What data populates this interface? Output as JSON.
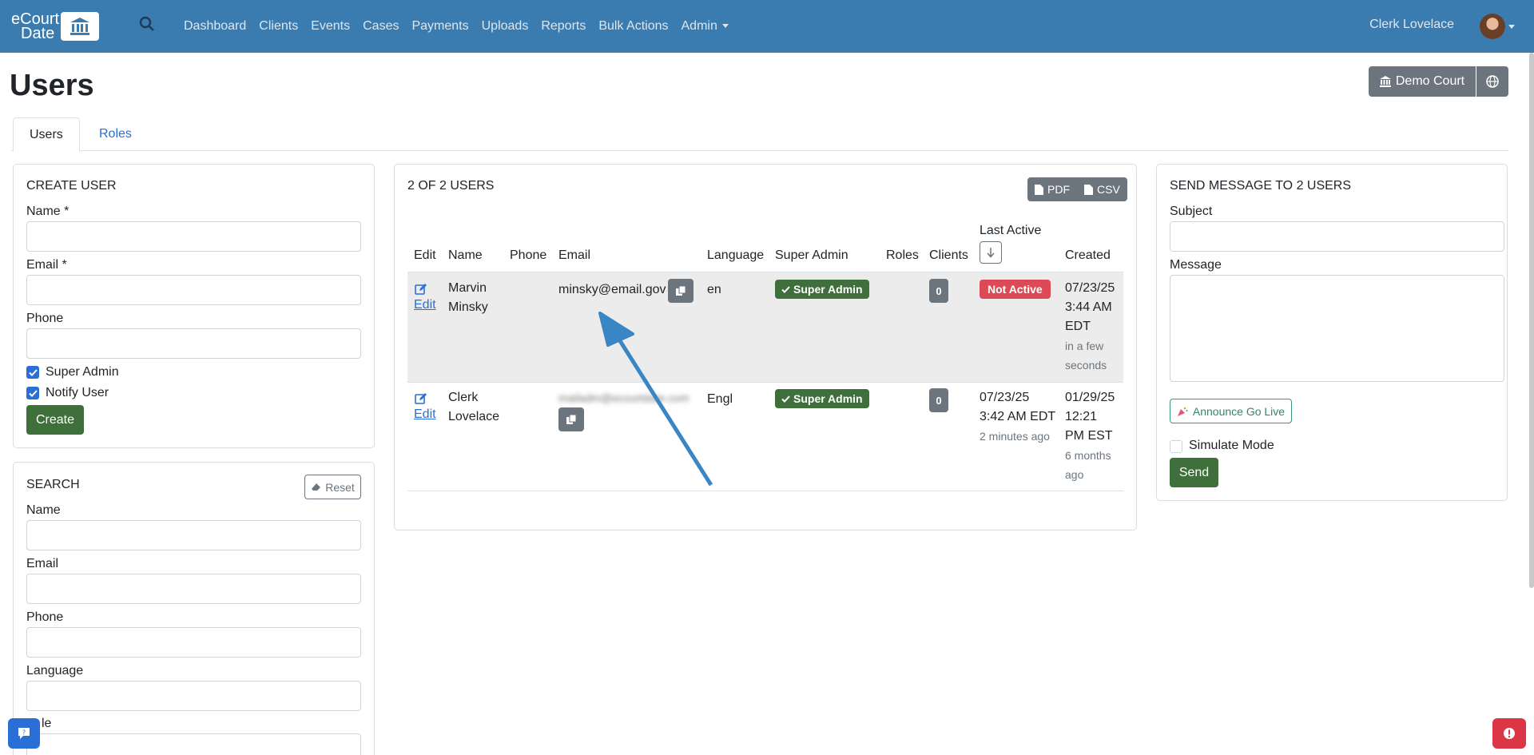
{
  "app": {
    "logo_line1": "eCourt",
    "logo_line2": "Date",
    "nav": [
      "Dashboard",
      "Clients",
      "Events",
      "Cases",
      "Payments",
      "Uploads",
      "Reports",
      "Bulk Actions",
      "Admin"
    ],
    "user_name": "Clerk Lovelace"
  },
  "page": {
    "title": "Users",
    "court_button": "Demo Court",
    "tabs": [
      "Users",
      "Roles"
    ]
  },
  "create_user": {
    "title": "CREATE USER",
    "name_label": "Name *",
    "email_label": "Email *",
    "phone_label": "Phone",
    "super_admin_label": "Super Admin",
    "super_admin_checked": true,
    "notify_user_label": "Notify User",
    "notify_user_checked": true,
    "create_button": "Create"
  },
  "search": {
    "title": "SEARCH",
    "reset_button": "Reset",
    "name_label": "Name",
    "email_label": "Email",
    "phone_label": "Phone",
    "language_label": "Language",
    "partial_label": "le"
  },
  "users_table": {
    "title": "2 OF 2 USERS",
    "pdf_button": "PDF",
    "csv_button": "CSV",
    "headers": {
      "edit": "Edit",
      "name": "Name",
      "phone": "Phone",
      "email": "Email",
      "language": "Language",
      "super_admin": "Super Admin",
      "roles": "Roles",
      "clients": "Clients",
      "last_active": "Last Active",
      "created": "Created"
    },
    "rows": [
      {
        "edit": "Edit",
        "name_line1": "Marvin",
        "name_line2": "Minsky",
        "email": "minsky@email.gov",
        "language": "en",
        "super_admin": "Super Admin",
        "clients": "0",
        "last_active_badge": "Not Active",
        "created_line1": "07/23/25",
        "created_line2": "3:44 AM",
        "created_line3": "EDT",
        "created_rel1": "in a few",
        "created_rel2": "seconds"
      },
      {
        "edit": "Edit",
        "name_line1": "Clerk",
        "name_line2": "Lovelace",
        "email_blurred": "mailadm@ecourtdate.com",
        "language": "Engl",
        "super_admin": "Super Admin",
        "clients": "0",
        "last_active_line1": "07/23/25",
        "last_active_line2": "3:42 AM EDT",
        "last_active_rel": "2 minutes ago",
        "created_line1": "01/29/25",
        "created_line2": "12:21",
        "created_line3": "PM EST",
        "created_rel1": "6 months",
        "created_rel2": "ago"
      }
    ]
  },
  "send_message": {
    "title": "SEND MESSAGE TO 2 USERS",
    "subject_label": "Subject",
    "message_label": "Message",
    "announce_button": "Announce Go Live",
    "simulate_label": "Simulate Mode",
    "simulate_checked": false,
    "send_button": "Send"
  },
  "colors": {
    "navbar": "#3b7cb0",
    "primary_green": "#3f6f3a",
    "danger": "#dc4b55",
    "link": "#2a6fd6",
    "arrow": "#3a86c4"
  }
}
